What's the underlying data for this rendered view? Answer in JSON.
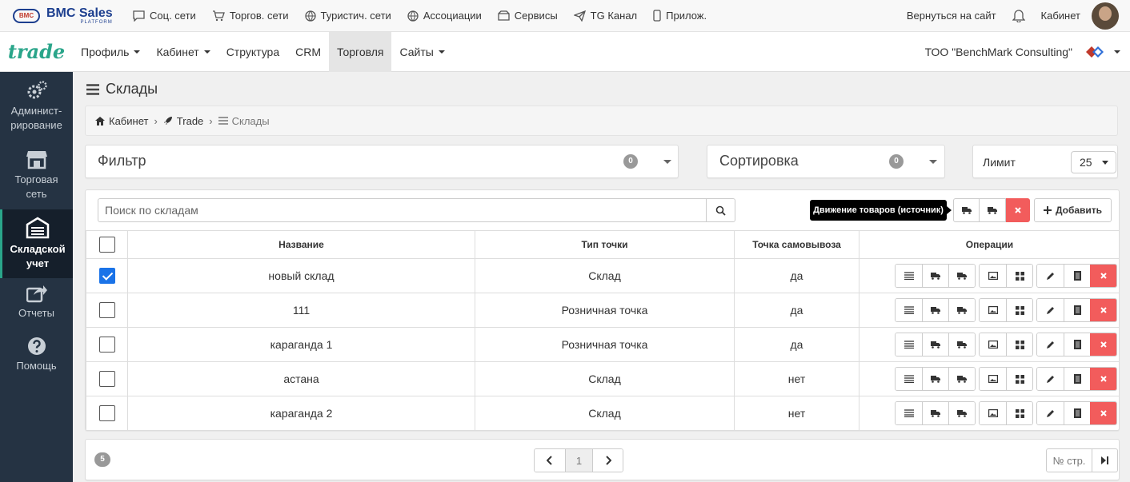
{
  "topbar": {
    "logo": {
      "badge": "BMC",
      "main": "BMC Sales",
      "sub": "PLATFORM"
    },
    "links": [
      {
        "label": "Соц. сети",
        "icon": "chat-icon"
      },
      {
        "label": "Торгов. сети",
        "icon": "cart-icon"
      },
      {
        "label": "Туристич. сети",
        "icon": "globe-icon"
      },
      {
        "label": "Ассоциации",
        "icon": "globe-icon"
      },
      {
        "label": "Сервисы",
        "icon": "box-icon"
      },
      {
        "label": "TG Канал",
        "icon": "send-icon"
      },
      {
        "label": "Прилож.",
        "icon": "phone-icon"
      }
    ],
    "back_label": "Вернуться на сайт",
    "cabinet_label": "Кабинет"
  },
  "navbar": {
    "brand": "trade",
    "items": [
      {
        "label": "Профиль",
        "dropdown": true
      },
      {
        "label": "Кабинет",
        "dropdown": true
      },
      {
        "label": "Структура",
        "dropdown": false
      },
      {
        "label": "CRM",
        "dropdown": false
      },
      {
        "label": "Торговля",
        "dropdown": false,
        "active": true
      },
      {
        "label": "Сайты",
        "dropdown": true
      }
    ],
    "company": "ТОО \"BenchMark Consulting\""
  },
  "sidebar": {
    "items": [
      {
        "label": "Админист-рирование",
        "icon": "gears-icon"
      },
      {
        "label": "Торговая сеть",
        "icon": "store-icon"
      },
      {
        "label": "Складской учет",
        "icon": "warehouse-icon",
        "active": true
      },
      {
        "label": "Отчеты",
        "icon": "share-icon"
      },
      {
        "label": "Помощь",
        "icon": "help-icon"
      }
    ]
  },
  "page": {
    "title": "Склады",
    "breadcrumb": [
      "Кабинет",
      "Trade",
      "Склады"
    ]
  },
  "filter": {
    "label": "Фильтр",
    "count": "0"
  },
  "sort": {
    "label": "Сортировка",
    "count": "0"
  },
  "limit": {
    "label": "Лимит",
    "value": "25"
  },
  "search": {
    "placeholder": "Поиск по складам"
  },
  "toolbar": {
    "tooltip": "Движение товаров (источник)",
    "add_label": "Добавить"
  },
  "table": {
    "headers": [
      "Название",
      "Тип точки",
      "Точка самовывоза",
      "Операции"
    ],
    "rows": [
      {
        "name": "новый склад",
        "type": "Склад",
        "pickup": "да",
        "checked": true
      },
      {
        "name": "111",
        "type": "Розничная точка",
        "pickup": "да",
        "checked": false
      },
      {
        "name": "караганда 1",
        "type": "Розничная точка",
        "pickup": "да",
        "checked": false
      },
      {
        "name": "астана",
        "type": "Склад",
        "pickup": "нет",
        "checked": false
      },
      {
        "name": "караганда 2",
        "type": "Склад",
        "pickup": "нет",
        "checked": false
      }
    ]
  },
  "footer": {
    "total": "5",
    "current_page": "1",
    "page_no_label": "№ стр."
  },
  "colors": {
    "accent": "#2aa58a",
    "danger": "#f25c5c",
    "sidebar": "#253343",
    "check": "#1a73e8"
  }
}
